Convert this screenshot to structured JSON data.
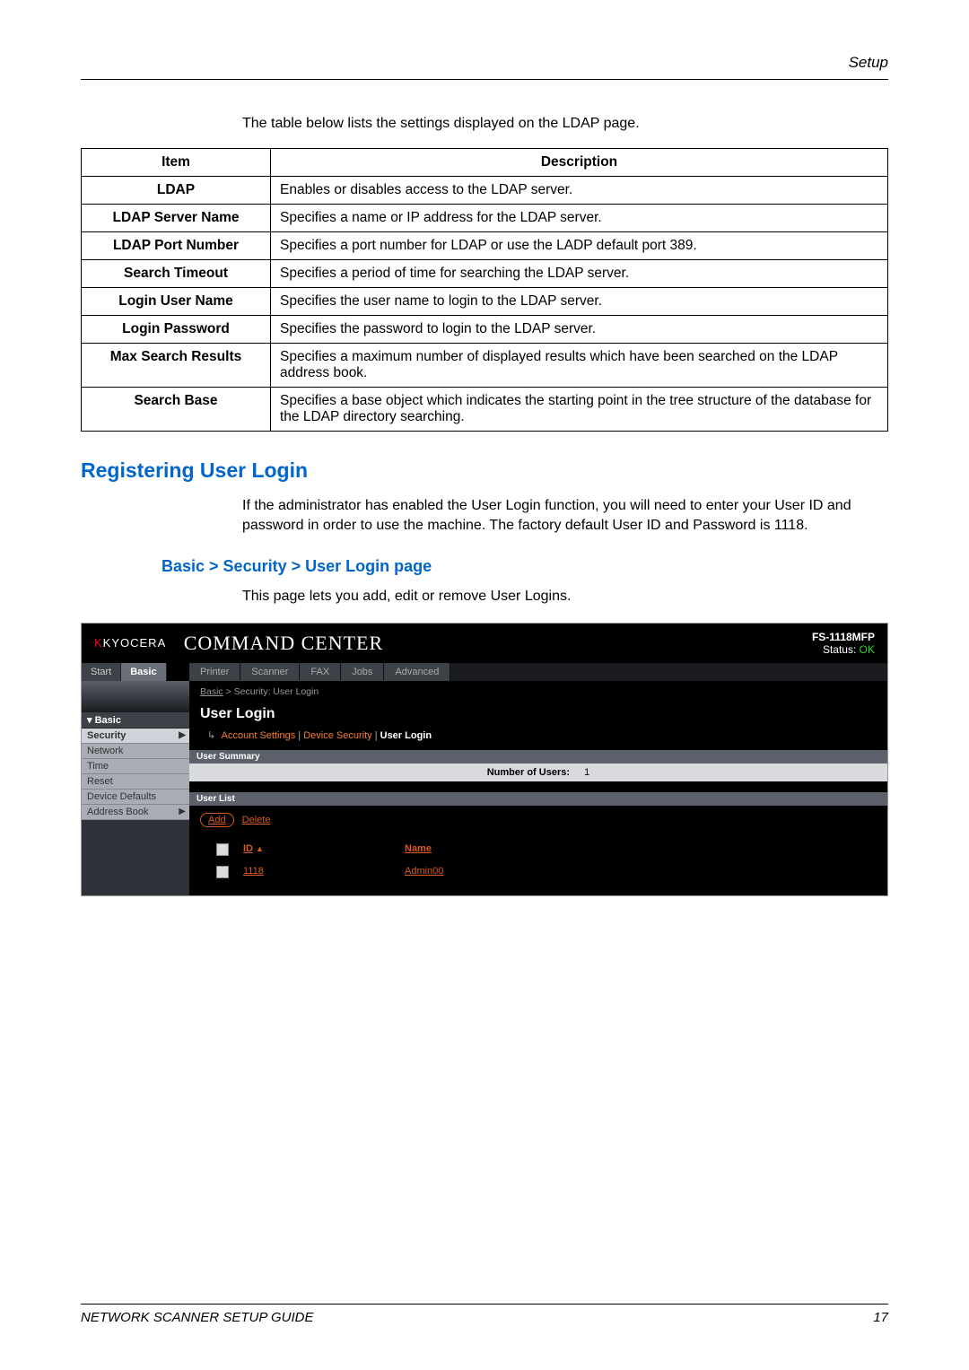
{
  "header": {
    "section_label": "Setup"
  },
  "intro": "The table below lists the settings displayed on the LDAP page.",
  "table": {
    "columns": [
      "Item",
      "Description"
    ],
    "rows": [
      {
        "item": "LDAP",
        "desc": "Enables or disables access to the LDAP server."
      },
      {
        "item": "LDAP Server Name",
        "desc": "Specifies a name or IP address for the LDAP server."
      },
      {
        "item": "LDAP Port Number",
        "desc": "Specifies a port number for LDAP or use the LADP default port 389."
      },
      {
        "item": "Search Timeout",
        "desc": "Specifies a period of time for searching the LDAP server."
      },
      {
        "item": "Login User Name",
        "desc": "Specifies the user name to login to the LDAP server."
      },
      {
        "item": "Login Password",
        "desc": "Specifies the password to login to the LDAP server."
      },
      {
        "item": "Max Search Results",
        "desc": "Specifies a maximum number of displayed results which have been searched on the LDAP address book."
      },
      {
        "item": "Search Base",
        "desc": "Specifies a base object which indicates the starting point in the tree structure of the database for the LDAP directory searching."
      }
    ]
  },
  "h2": "Registering User Login",
  "para1": "If the administrator has enabled the User Login function, you will need to enter your User ID and password in order to use the machine. The factory default User ID and Password is 1118.",
  "h3": "Basic > Security > User Login page",
  "para2": "This page lets you add, edit or remove User Logins.",
  "screenshot": {
    "brand_prefix": "K",
    "brand": "KYOCERA",
    "app_title": "COMMAND CENTER",
    "model": "FS-1118MFP",
    "status_label": "Status:",
    "status_value": "OK",
    "top_tabs_left": [
      "Start",
      "Basic"
    ],
    "top_tabs_right": [
      "Printer",
      "Scanner",
      "FAX",
      "Jobs",
      "Advanced"
    ],
    "breadcrumb": {
      "a": "Basic",
      "sep": " > ",
      "b": "Security: User Login"
    },
    "sidebar_header": "Basic",
    "sidebar": [
      {
        "label": "Security",
        "arrow": true,
        "sel": true
      },
      {
        "label": "Network"
      },
      {
        "label": "Time"
      },
      {
        "label": "Reset"
      },
      {
        "label": "Device Defaults"
      },
      {
        "label": "Address Book",
        "arrow": true
      }
    ],
    "page_title": "User Login",
    "sub_links_prefix": "↳",
    "sub_links": {
      "a": "Account Settings",
      "b": "Device Security",
      "c": "User Login"
    },
    "section_summary": "User Summary",
    "num_users_label": "Number of Users:",
    "num_users_value": "1",
    "section_list": "User List",
    "actions": {
      "add": "Add",
      "delete": "Delete"
    },
    "list_headers": {
      "id": "ID",
      "name": "Name"
    },
    "list_rows": [
      {
        "id": "1118",
        "name": "Admin00"
      }
    ]
  },
  "footer": {
    "left": "NETWORK SCANNER SETUP GUIDE",
    "page": "17"
  }
}
